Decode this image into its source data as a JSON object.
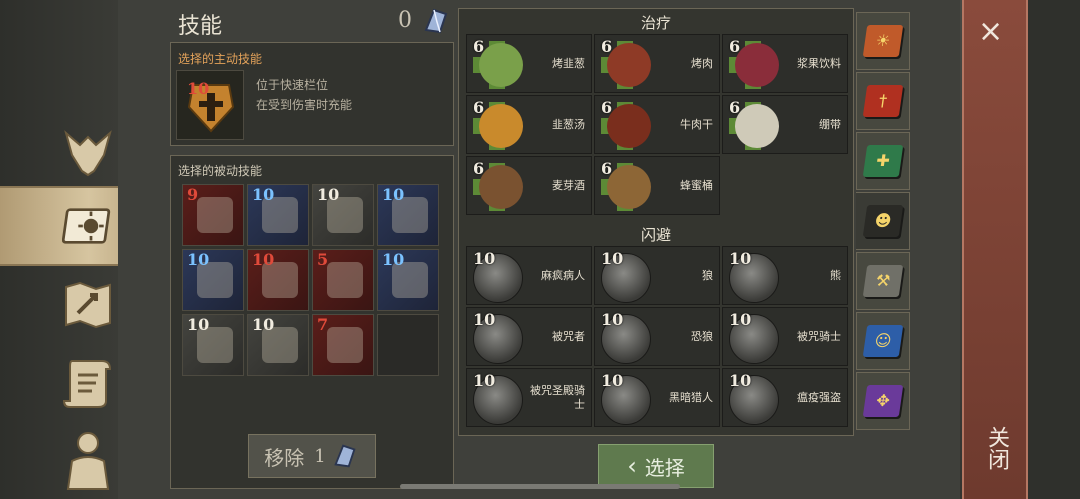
{
  "skills_title": "技能",
  "skill_points": "0",
  "active": {
    "header": "选择的主动技能",
    "level": "10",
    "desc_line1": "位于快速栏位",
    "desc_line2": "在受到伤害时充能"
  },
  "passive": {
    "header": "选择的被动技能",
    "slots": [
      {
        "level": "9",
        "color": "red",
        "icon": "feather-icon"
      },
      {
        "level": "10",
        "color": "blue",
        "icon": "map-icon"
      },
      {
        "level": "10",
        "color": "gray",
        "icon": "berries-icon"
      },
      {
        "level": "10",
        "color": "blue",
        "icon": "gauntlet-icon"
      },
      {
        "level": "10",
        "color": "blue",
        "icon": "boot-icon"
      },
      {
        "level": "10",
        "color": "red",
        "icon": "medkit-icon"
      },
      {
        "level": "5",
        "color": "red",
        "icon": "axe-icon"
      },
      {
        "level": "10",
        "color": "blue",
        "icon": "level-up-icon"
      },
      {
        "level": "10",
        "color": "gray",
        "icon": "rock-icon"
      },
      {
        "level": "10",
        "color": "gray",
        "icon": "ore-icon"
      },
      {
        "level": "7",
        "color": "red",
        "icon": "club-icon"
      },
      {
        "level": "",
        "color": "empty",
        "icon": ""
      }
    ]
  },
  "remove_button": {
    "label": "移除",
    "count": "1"
  },
  "healing": {
    "title": "治疗",
    "items": [
      {
        "level": "6",
        "name": "烤韭葱",
        "color": "#7aa04a"
      },
      {
        "level": "6",
        "name": "烤肉",
        "color": "#8e3a26"
      },
      {
        "level": "6",
        "name": "浆果饮料",
        "color": "#8a2d3a"
      },
      {
        "level": "6",
        "name": "韭葱汤",
        "color": "#c98a2c"
      },
      {
        "level": "6",
        "name": "牛肉干",
        "color": "#7a2e1d"
      },
      {
        "level": "6",
        "name": "绷带",
        "color": "#cfcab8"
      },
      {
        "level": "6",
        "name": "麦芽酒",
        "color": "#7a5230"
      },
      {
        "level": "6",
        "name": "蜂蜜桶",
        "color": "#8d6636"
      }
    ]
  },
  "dodge": {
    "title": "闪避",
    "items": [
      {
        "level": "10",
        "name": "麻疯病人"
      },
      {
        "level": "10",
        "name": "狼"
      },
      {
        "level": "10",
        "name": "熊"
      },
      {
        "level": "10",
        "name": "被咒者"
      },
      {
        "level": "10",
        "name": "恐狼"
      },
      {
        "level": "10",
        "name": "被咒骑士"
      },
      {
        "level": "10",
        "name": "被咒圣殿骑士"
      },
      {
        "level": "10",
        "name": "黑暗猎人"
      },
      {
        "level": "10",
        "name": "瘟疫强盗"
      }
    ]
  },
  "select_button": "选择",
  "close_label": "关闭",
  "close_icon": "×",
  "colors": {
    "accent": "#e3a25a",
    "level_red": "#e04a3a",
    "level_blue": "#7bc2ff"
  }
}
